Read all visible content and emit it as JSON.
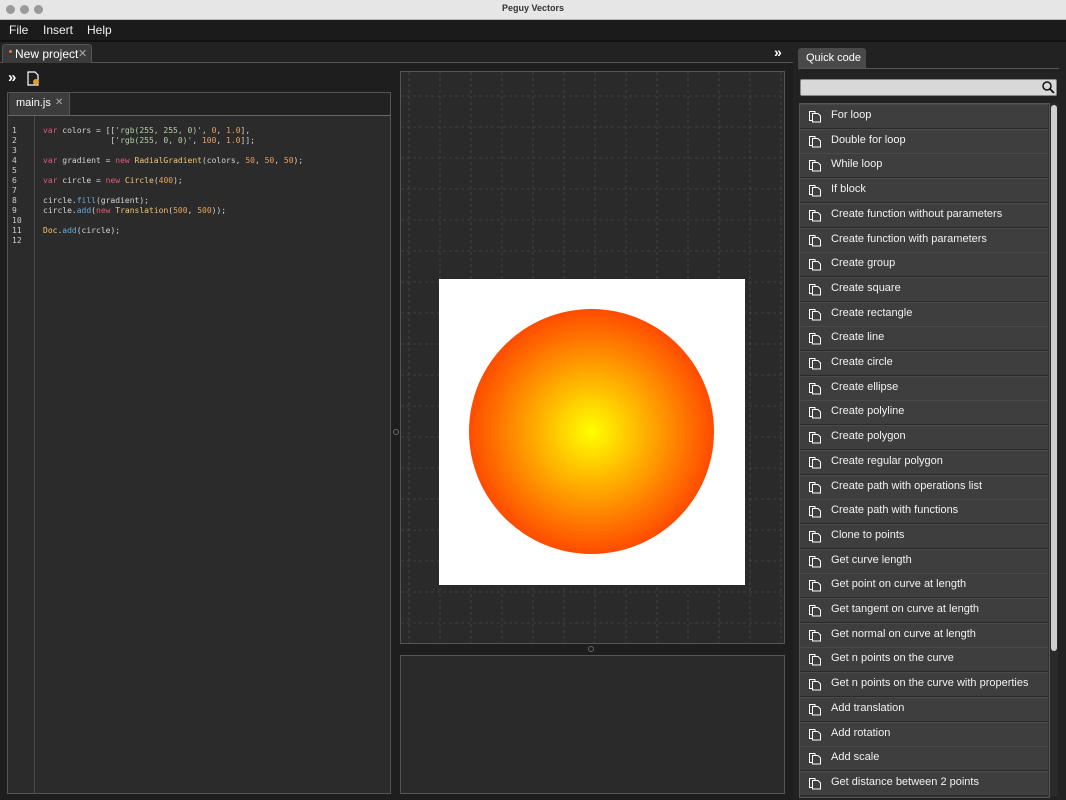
{
  "window": {
    "title": "Peguy Vectors"
  },
  "menu": [
    "File",
    "Insert",
    "Help"
  ],
  "project_tab": {
    "label": "New project",
    "close": "✕"
  },
  "editor": {
    "tab_label": "main.js",
    "tab_close": "✕",
    "line_numbers": [
      "1",
      "2",
      "3",
      "4",
      "5",
      "6",
      "7",
      "8",
      "9",
      "10",
      "11",
      "12"
    ]
  },
  "canvas": {
    "background": "#2a2a2a",
    "gradient_inner": "#ffff00",
    "gradient_outer": "#ff0000"
  },
  "quick_code": {
    "tab_label": "Quick code",
    "search_placeholder": "",
    "items": [
      "For loop",
      "Double for loop",
      "While loop",
      "If block",
      "Create function without parameters",
      "Create function with parameters",
      "Create group",
      "Create square",
      "Create rectangle",
      "Create line",
      "Create circle",
      "Create ellipse",
      "Create polyline",
      "Create polygon",
      "Create regular polygon",
      "Create path with operations list",
      "Create path with functions",
      "Clone to points",
      "Get curve length",
      "Get point on curve at length",
      "Get tangent on curve at length",
      "Get normal on curve at length",
      "Get n points on the curve",
      "Get n points on the curve with properties",
      "Add translation",
      "Add rotation",
      "Add scale",
      "Get distance between 2 points"
    ]
  },
  "colors": {
    "accent": "#e07a3a"
  }
}
